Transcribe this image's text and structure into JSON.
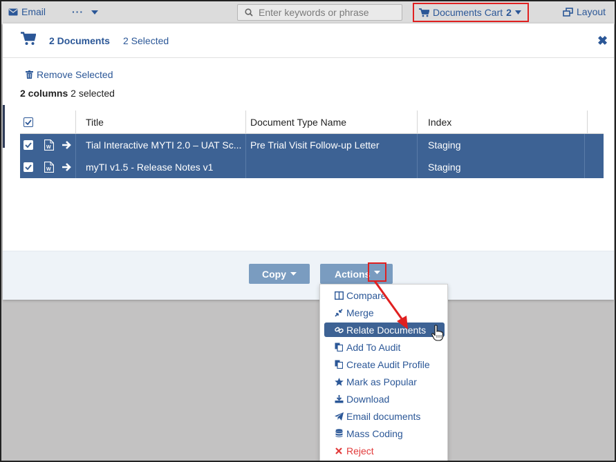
{
  "topbar": {
    "email_label": "Email",
    "more_label": "···",
    "search_placeholder": "Enter keywords or phrase",
    "cart_label": "Documents Cart",
    "cart_count": "2",
    "layout_label": "Layout"
  },
  "panel": {
    "docs_label": "2 Documents",
    "selected_label": "2 Selected",
    "remove_selected": "Remove Selected",
    "columns_count": "2 columns",
    "columns_selected": "2 selected"
  },
  "table": {
    "headers": [
      "Title",
      "Document Type Name",
      "Index"
    ],
    "rows": [
      {
        "title": "Tial Interactive MYTI 2.0 – UAT Sc...",
        "doc_type": "Pre Trial Visit Follow-up Letter",
        "index": "Staging"
      },
      {
        "title": "myTI v1.5 - Release Notes v1",
        "doc_type": "",
        "index": "Staging"
      }
    ]
  },
  "footer": {
    "copy_label": "Copy",
    "actions_label": "Actions"
  },
  "menu": {
    "items": [
      {
        "label": "Compare",
        "icon": "columns-icon"
      },
      {
        "label": "Merge",
        "icon": "compress-icon"
      },
      {
        "label": "Relate Documents",
        "icon": "link-icon"
      },
      {
        "label": "Add To Audit",
        "icon": "copy-icon"
      },
      {
        "label": "Create Audit Profile",
        "icon": "copy-icon"
      },
      {
        "label": "Mark as Popular",
        "icon": "star-icon"
      },
      {
        "label": "Download",
        "icon": "download-icon"
      },
      {
        "label": "Email documents",
        "icon": "paper-plane-icon"
      },
      {
        "label": "Mass Coding",
        "icon": "database-icon"
      },
      {
        "label": "Reject",
        "icon": "times-icon"
      }
    ],
    "active_item": "Relate Documents"
  },
  "colors": {
    "accent": "#2b5797",
    "row_selected": "#3d6294",
    "button": "#7a9cc0",
    "highlight_box": "#e02020",
    "reject": "#e23a3a"
  }
}
